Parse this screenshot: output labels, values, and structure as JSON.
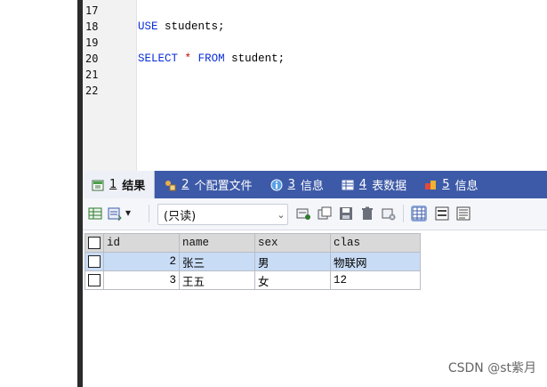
{
  "editor": {
    "line_numbers": [
      "17",
      "18",
      "19",
      "20",
      "21",
      "22"
    ],
    "line18": {
      "kw": "USE",
      "rest": " students;"
    },
    "line20": {
      "kw1": "SELECT",
      "star": "*",
      "kw2": "FROM",
      "rest": " student;"
    }
  },
  "tabs": [
    {
      "num": "1",
      "label": "结果",
      "icon": "result-icon",
      "active": true
    },
    {
      "num": "2",
      "label": "个配置文件",
      "icon": "profile-icon"
    },
    {
      "num": "3",
      "label": "信息",
      "icon": "info-icon"
    },
    {
      "num": "4",
      "label": "表数据",
      "icon": "table-data-icon"
    },
    {
      "num": "5",
      "label": "信息",
      "icon": "info-icon-2"
    }
  ],
  "toolbar": {
    "mode_select": "(只读)"
  },
  "grid": {
    "columns": [
      "id",
      "name",
      "sex",
      "clas"
    ],
    "rows": [
      {
        "id": "2",
        "name": "张三",
        "sex": "男",
        "clas": "物联网",
        "selected": true
      },
      {
        "id": "3",
        "name": "王五",
        "sex": "女",
        "clas": "12",
        "selected": false
      }
    ]
  },
  "watermark": "CSDN @st紫月"
}
